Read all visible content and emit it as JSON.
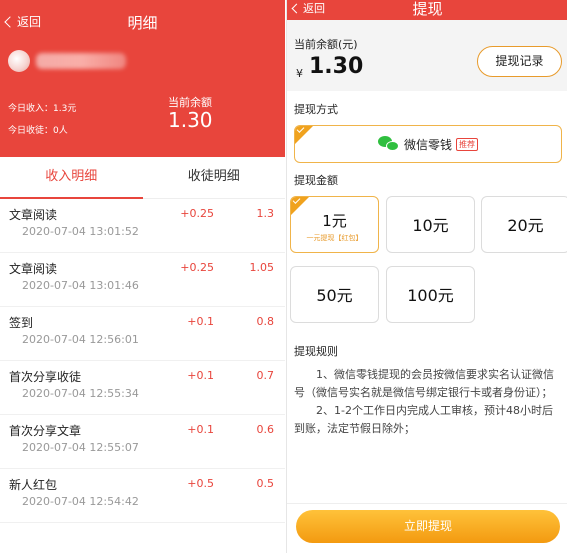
{
  "detail": {
    "back_label": "返回",
    "title": "明细",
    "today_income": "今日收入：1.3元",
    "today_recruit": "今日收徒：0人",
    "balance_label": "当前余额",
    "balance_value": "1.30",
    "tabs": [
      {
        "label": "收入明细",
        "active": true
      },
      {
        "label": "收徒明细",
        "active": false
      }
    ],
    "records": [
      {
        "name": "文章阅读",
        "time": "2020-07-04 13:01:52",
        "delta": "+0.25",
        "total": "1.3"
      },
      {
        "name": "文章阅读",
        "time": "2020-07-04 13:01:46",
        "delta": "+0.25",
        "total": "1.05"
      },
      {
        "name": "签到",
        "time": "2020-07-04 12:56:01",
        "delta": "+0.1",
        "total": "0.8"
      },
      {
        "name": "首次分享收徒",
        "time": "2020-07-04 12:55:34",
        "delta": "+0.1",
        "total": "0.7"
      },
      {
        "name": "首次分享文章",
        "time": "2020-07-04 12:55:07",
        "delta": "+0.1",
        "total": "0.6"
      },
      {
        "name": "新人红包",
        "time": "2020-07-04 12:54:42",
        "delta": "+0.5",
        "total": "0.5"
      }
    ]
  },
  "withdraw": {
    "back_label": "返回",
    "title": "提现",
    "balance_label": "当前余额(元)",
    "currency": "¥",
    "balance_value": "1.30",
    "record_button": "提现记录",
    "method_label": "提现方式",
    "method_name": "微信零钱",
    "method_tag": "推荐",
    "amount_label": "提现金额",
    "amounts": [
      {
        "value": "1元",
        "sub": "一元提现【红包】",
        "selected": true
      },
      {
        "value": "10元",
        "selected": false
      },
      {
        "value": "20元",
        "selected": false
      },
      {
        "value": "50元",
        "selected": false
      },
      {
        "value": "100元",
        "selected": false
      }
    ],
    "rules_title": "提现规则",
    "rules": [
      "1、微信零钱提现的会员按微信要求实名认证微信号（微信号实名就是微信号绑定银行卡或者身份证）；",
      "2、1-2个工作日内完成人工审核，预计48小时后到账，法定节假日除外；"
    ],
    "submit_label": "立即提现"
  },
  "colors": {
    "primary_red": "#e8453c",
    "accent_orange": "#f0a21e",
    "wechat_green": "#2fbf3f"
  }
}
